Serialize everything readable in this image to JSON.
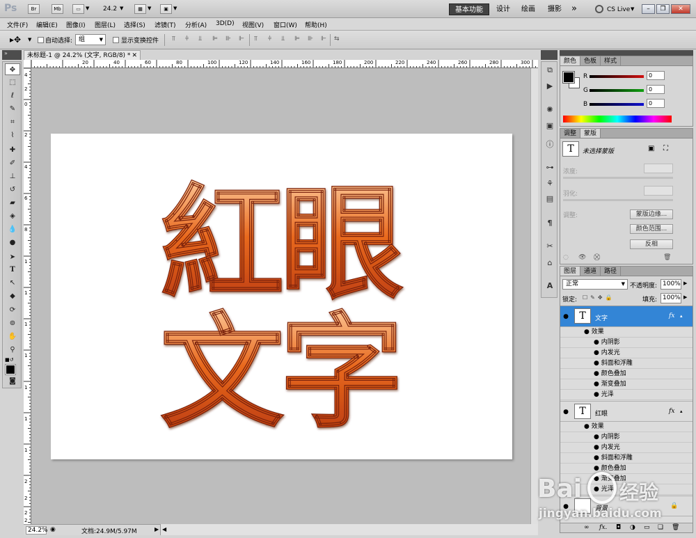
{
  "app": {
    "logo": "Ps",
    "top_buttons": [
      "Br",
      "Mb"
    ],
    "zoom_value": "24.2",
    "workspaces": [
      "基本功能",
      "设计",
      "绘画",
      "摄影"
    ],
    "more": "»",
    "cslive": "CS Live",
    "accent": "#3385d6"
  },
  "menu": [
    "文件(F)",
    "编辑(E)",
    "图像(I)",
    "图层(L)",
    "选择(S)",
    "滤镜(T)",
    "分析(A)",
    "3D(D)",
    "视图(V)",
    "窗口(W)",
    "帮助(H)"
  ],
  "options": {
    "auto_select_label": "自动选择:",
    "auto_select_value": "组",
    "show_transform_label": "显示变换控件"
  },
  "document": {
    "tab_title": "未标题-1 @ 24.2% (文字, RGB/8) *",
    "ruler_h_labels": [
      "20",
      "40",
      "60",
      "80",
      "100",
      "120",
      "140",
      "160",
      "180",
      "200",
      "220",
      "240",
      "260",
      "280",
      "300"
    ],
    "ruler_v_labels": [
      "4",
      "2",
      "0",
      "2",
      "4",
      "6",
      "8",
      "1",
      "1",
      "1",
      "1",
      "1",
      "1",
      "1",
      "2",
      "2",
      "2",
      "2"
    ],
    "artwork_text": [
      "紅",
      "眼",
      "文",
      "字"
    ],
    "artwork_colors": {
      "stroke": "#7a2208",
      "mid": "#e8691e",
      "light": "#ffc48a"
    },
    "status_zoom": "24.2%",
    "status_doc": "文档:24.9M/5.97M"
  },
  "color_panel": {
    "tabs": [
      "颜色",
      "色板",
      "样式"
    ],
    "channels": [
      {
        "label": "R",
        "value": "0",
        "color": "#d01010"
      },
      {
        "label": "G",
        "value": "0",
        "color": "#10a010"
      },
      {
        "label": "B",
        "value": "0",
        "color": "#1010d0"
      }
    ]
  },
  "masks_panel": {
    "tabs": [
      "调整",
      "蒙版"
    ],
    "title": "未选择蒙版",
    "density_label": "浓度:",
    "feather_label": "羽化:",
    "refine_label": "调整:",
    "buttons": [
      "蒙版边缘...",
      "颜色范围...",
      "反相"
    ]
  },
  "layers_panel": {
    "tabs": [
      "图层",
      "通道",
      "路径"
    ],
    "blend_mode": "正常",
    "opacity_label": "不透明度:",
    "opacity_value": "100%",
    "lock_label": "锁定:",
    "fill_label": "填充:",
    "fill_value": "100%",
    "layers": [
      {
        "name": "文字",
        "effects_label": "效果",
        "effects": [
          "内阴影",
          "内发光",
          "斜面和浮雕",
          "颜色叠加",
          "渐变叠加",
          "光泽"
        ]
      },
      {
        "name": "红眼",
        "effects_label": "效果",
        "effects": [
          "内阴影",
          "内发光",
          "斜面和浮雕",
          "颜色叠加",
          "渐变叠加",
          "光泽"
        ]
      }
    ],
    "background_layer": "背景",
    "fx_badge": "fx"
  },
  "watermark": {
    "brand": "Bai",
    "brand2": "经验",
    "url": "jingyan.baidu.com"
  }
}
